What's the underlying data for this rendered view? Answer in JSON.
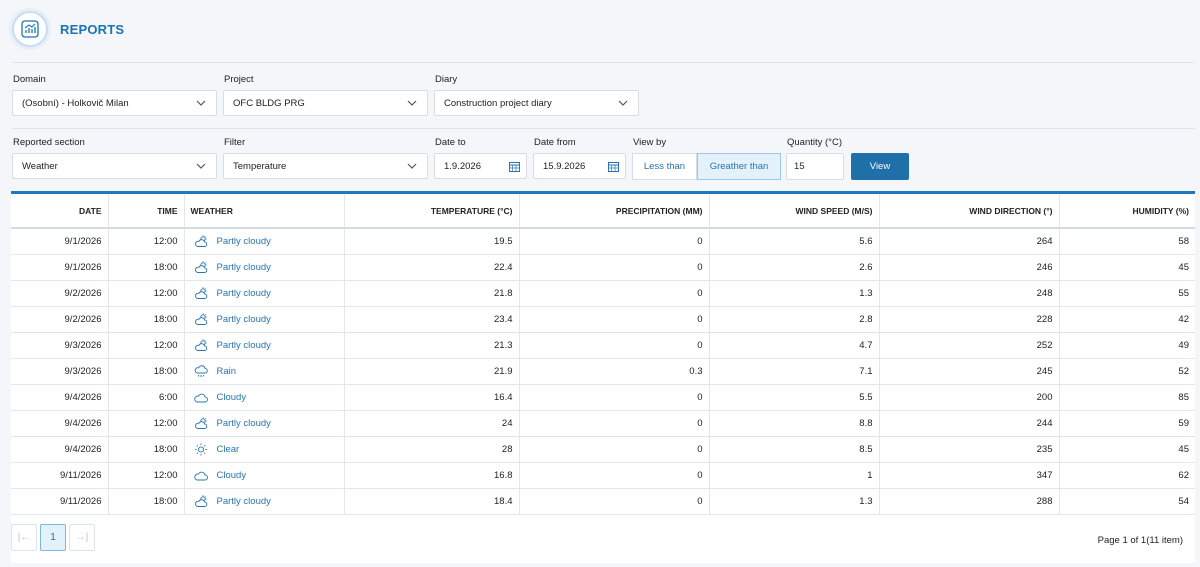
{
  "header": {
    "title": "REPORTS",
    "icon": "report-chart-icon"
  },
  "filters_row1": {
    "domain_label": "Domain",
    "domain_value": "(Osobní) - Holkovič Milan",
    "project_label": "Project",
    "project_value": "OFC BLDG PRG",
    "diary_label": "Diary",
    "diary_value": "Construction project diary"
  },
  "filters_row2": {
    "section_label": "Reported section",
    "section_value": "Weather",
    "filter_label": "Filter",
    "filter_value": "Temperature",
    "date_to_label": "Date to",
    "date_to_value": "1.9.2026",
    "date_from_label": "Date from",
    "date_from_value": "15.9.2026",
    "view_by_label": "View by",
    "less_than": "Less than",
    "greater_than": "Greather than",
    "quantity_label": "Quantity (°C)",
    "quantity_value": "15",
    "view_button": "View"
  },
  "table": {
    "columns": [
      "DATE",
      "TIME",
      "WEATHER",
      "TEMPERATURE (°C)",
      "PRECIPITATION (MM)",
      "WIND SPEED (M/S)",
      "WIND DIRECTION (°)",
      "HUMIDITY (%)"
    ],
    "rows": [
      {
        "date": "9/1/2026",
        "time": "12:00",
        "icon": "partly-cloudy-icon",
        "weather": "Partly cloudy",
        "temp": "19.5",
        "precip": "0",
        "wind": "5.6",
        "dir": "264",
        "hum": "58"
      },
      {
        "date": "9/1/2026",
        "time": "18:00",
        "icon": "partly-cloudy-icon",
        "weather": "Partly cloudy",
        "temp": "22.4",
        "precip": "0",
        "wind": "2.6",
        "dir": "246",
        "hum": "45"
      },
      {
        "date": "9/2/2026",
        "time": "12:00",
        "icon": "partly-cloudy-icon",
        "weather": "Partly cloudy",
        "temp": "21.8",
        "precip": "0",
        "wind": "1.3",
        "dir": "248",
        "hum": "55"
      },
      {
        "date": "9/2/2026",
        "time": "18:00",
        "icon": "partly-cloudy-icon",
        "weather": "Partly cloudy",
        "temp": "23.4",
        "precip": "0",
        "wind": "2.8",
        "dir": "228",
        "hum": "42"
      },
      {
        "date": "9/3/2026",
        "time": "12:00",
        "icon": "partly-cloudy-icon",
        "weather": "Partly cloudy",
        "temp": "21.3",
        "precip": "0",
        "wind": "4.7",
        "dir": "252",
        "hum": "49"
      },
      {
        "date": "9/3/2026",
        "time": "18:00",
        "icon": "rain-icon",
        "weather": "Rain",
        "temp": "21.9",
        "precip": "0.3",
        "wind": "7.1",
        "dir": "245",
        "hum": "52"
      },
      {
        "date": "9/4/2026",
        "time": "6:00",
        "icon": "cloudy-icon",
        "weather": "Cloudy",
        "temp": "16.4",
        "precip": "0",
        "wind": "5.5",
        "dir": "200",
        "hum": "85"
      },
      {
        "date": "9/4/2026",
        "time": "12:00",
        "icon": "partly-cloudy-icon",
        "weather": "Partly cloudy",
        "temp": "24",
        "precip": "0",
        "wind": "8.8",
        "dir": "244",
        "hum": "59"
      },
      {
        "date": "9/4/2026",
        "time": "18:00",
        "icon": "clear-sun-icon",
        "weather": "Clear",
        "temp": "28",
        "precip": "0",
        "wind": "8.5",
        "dir": "235",
        "hum": "45"
      },
      {
        "date": "9/11/2026",
        "time": "12:00",
        "icon": "cloudy-icon",
        "weather": "Cloudy",
        "temp": "16.8",
        "precip": "0",
        "wind": "1",
        "dir": "347",
        "hum": "62"
      },
      {
        "date": "9/11/2026",
        "time": "18:00",
        "icon": "partly-cloudy-icon",
        "weather": "Partly cloudy",
        "temp": "18.4",
        "precip": "0",
        "wind": "1.3",
        "dir": "288",
        "hum": "54"
      }
    ]
  },
  "pagination": {
    "first": "|←",
    "current": "1",
    "last": "→|",
    "info": "Page 1 of 1(11 item)"
  },
  "colors": {
    "accent": "#1e78bd",
    "link": "#2a74b4",
    "button": "#1f6fa9"
  }
}
